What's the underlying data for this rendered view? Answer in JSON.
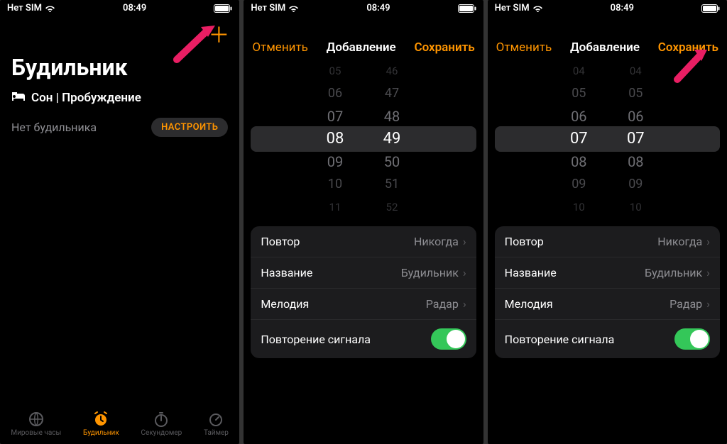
{
  "status": {
    "carrier": "Нет SIM",
    "time": "08:49"
  },
  "screen1": {
    "title": "Будильник",
    "sleep_label": "Сон | Пробуждение",
    "no_alarm": "Нет будильника",
    "setup": "НАСТРОИТЬ",
    "tabs": {
      "world": "Мировые часы",
      "alarm": "Будильник",
      "stopwatch": "Секундомер",
      "timer": "Таймер"
    }
  },
  "nav": {
    "cancel": "Отменить",
    "title": "Добавление",
    "save": "Сохранить"
  },
  "picker2": {
    "h": [
      "05",
      "06",
      "07",
      "08",
      "09",
      "10",
      "11"
    ],
    "m": [
      "46",
      "47",
      "48",
      "49",
      "50",
      "51",
      "52"
    ]
  },
  "picker3": {
    "h": [
      "04",
      "05",
      "06",
      "07",
      "08",
      "09",
      "10"
    ],
    "m": [
      "04",
      "05",
      "06",
      "07",
      "08",
      "09",
      "10"
    ]
  },
  "settings": {
    "repeat_label": "Повтор",
    "repeat_value": "Никогда",
    "name_label": "Название",
    "name_value": "Будильник",
    "sound_label": "Мелодия",
    "sound_value": "Радар",
    "snooze_label": "Повторение сигнала"
  }
}
